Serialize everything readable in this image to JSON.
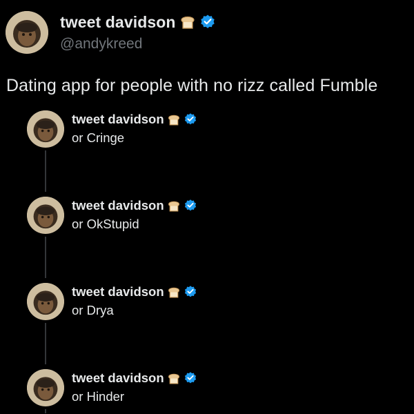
{
  "post": {
    "author_name": "tweet davidson",
    "handle": "@andykreed",
    "text": "Dating app for people with no rizz called Fumble",
    "name_emoji_icon": "bread-emoji-icon",
    "verified_icon": "verified-badge-icon"
  },
  "replies": [
    {
      "author_name": "tweet davidson",
      "text": "or Cringe"
    },
    {
      "author_name": "tweet davidson",
      "text": "or OkStupid"
    },
    {
      "author_name": "tweet davidson",
      "text": "or Drya"
    },
    {
      "author_name": "tweet davidson",
      "text": "or Hinder"
    }
  ],
  "colors": {
    "background": "#000000",
    "primary_text": "#e7e9ea",
    "secondary_text": "#71767b",
    "verified_blue": "#1d9bf0",
    "thread_line": "#333639"
  }
}
